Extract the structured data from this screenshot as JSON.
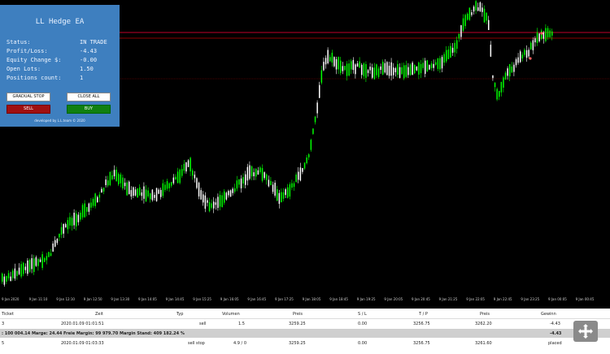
{
  "ea_panel": {
    "title": "LL Hedge EA",
    "rows": [
      {
        "label": "Status:",
        "value": "IN TRADE"
      },
      {
        "label": "Profit/Loss:",
        "value": "-4.43"
      },
      {
        "label": "Equity Change $:",
        "value": "-0.00"
      },
      {
        "label": "Open Lots:",
        "value": "1.50"
      },
      {
        "label": "Positions count:",
        "value": "1"
      }
    ],
    "buttons": {
      "gradual_stop": "GRADUAL STOP",
      "close_all": "CLOSE ALL",
      "sell": "SELL",
      "buy": "BUY"
    },
    "footer": "developed by L.L.team © 2020"
  },
  "chart": {
    "time_labels": [
      "9 Jan 2020",
      "9 Jan 11:10",
      "9 Jan 12:10",
      "9 Jan 12:50",
      "9 Jan 13:30",
      "9 Jan 14:05",
      "9 Jan 14:45",
      "9 Jan 15:25",
      "9 Jan 16:05",
      "9 Jan 16:45",
      "9 Jan 17:25",
      "9 Jan 18:05",
      "9 Jan 18:45",
      "9 Jan 19:25",
      "9 Jan 20:05",
      "9 Jan 20:45",
      "9 Jan 21:25",
      "9 Jan 22:05",
      "9 Jan 22:45",
      "9 Jan 23:25",
      "9 Jan 00:05",
      "9 Jan 00:45"
    ],
    "colors": {
      "bull": "#00ff00",
      "bear": "#ffffff",
      "hline_top": "#c0002a",
      "hline_bottom": "#8b0000"
    }
  },
  "trades": {
    "headers": [
      "Ticket",
      "Zeit",
      "Typ",
      "Volumen",
      "Preis",
      "S / L",
      "T / P",
      "Preis",
      "Gewinn"
    ],
    "row1": [
      "3",
      "2020.01.09 01:01:51",
      "sell",
      "1.5",
      "3259.25",
      "0.00",
      "3256.75",
      "3262.20",
      "-4.43"
    ],
    "summary": {
      "text": ": 100 004.14  Marge: 24.44  Freie Margin: 99 979.70  Margin Stand: 409 182.24 %",
      "total": "-4.43"
    },
    "row2": [
      "5",
      "2020.01.09 01:03:33",
      "sell stop",
      "4.9 / 0",
      "3259.25",
      "0.00",
      "3256.75",
      "3261.60",
      "placed"
    ]
  }
}
